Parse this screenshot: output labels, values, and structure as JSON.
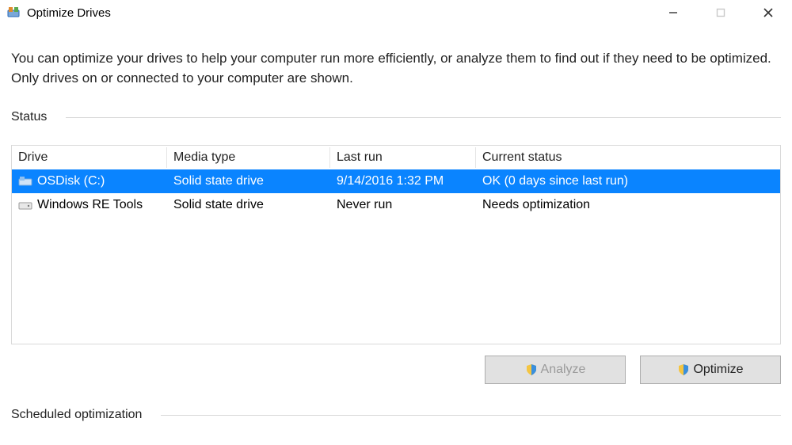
{
  "window": {
    "title": "Optimize Drives"
  },
  "description": "You can optimize your drives to help your computer run more efficiently, or analyze them to find out if they need to be optimized. Only drives on or connected to your computer are shown.",
  "sections": {
    "status_label": "Status",
    "scheduled_label": "Scheduled optimization"
  },
  "table": {
    "headers": {
      "drive": "Drive",
      "media_type": "Media type",
      "last_run": "Last run",
      "current_status": "Current status"
    },
    "rows": [
      {
        "drive": "OSDisk (C:)",
        "media_type": "Solid state drive",
        "last_run": "9/14/2016 1:32 PM",
        "current_status": "OK (0 days since last run)",
        "selected": true
      },
      {
        "drive": "Windows RE Tools",
        "media_type": "Solid state drive",
        "last_run": "Never run",
        "current_status": "Needs optimization",
        "selected": false
      }
    ]
  },
  "buttons": {
    "analyze": "Analyze",
    "optimize": "Optimize"
  }
}
